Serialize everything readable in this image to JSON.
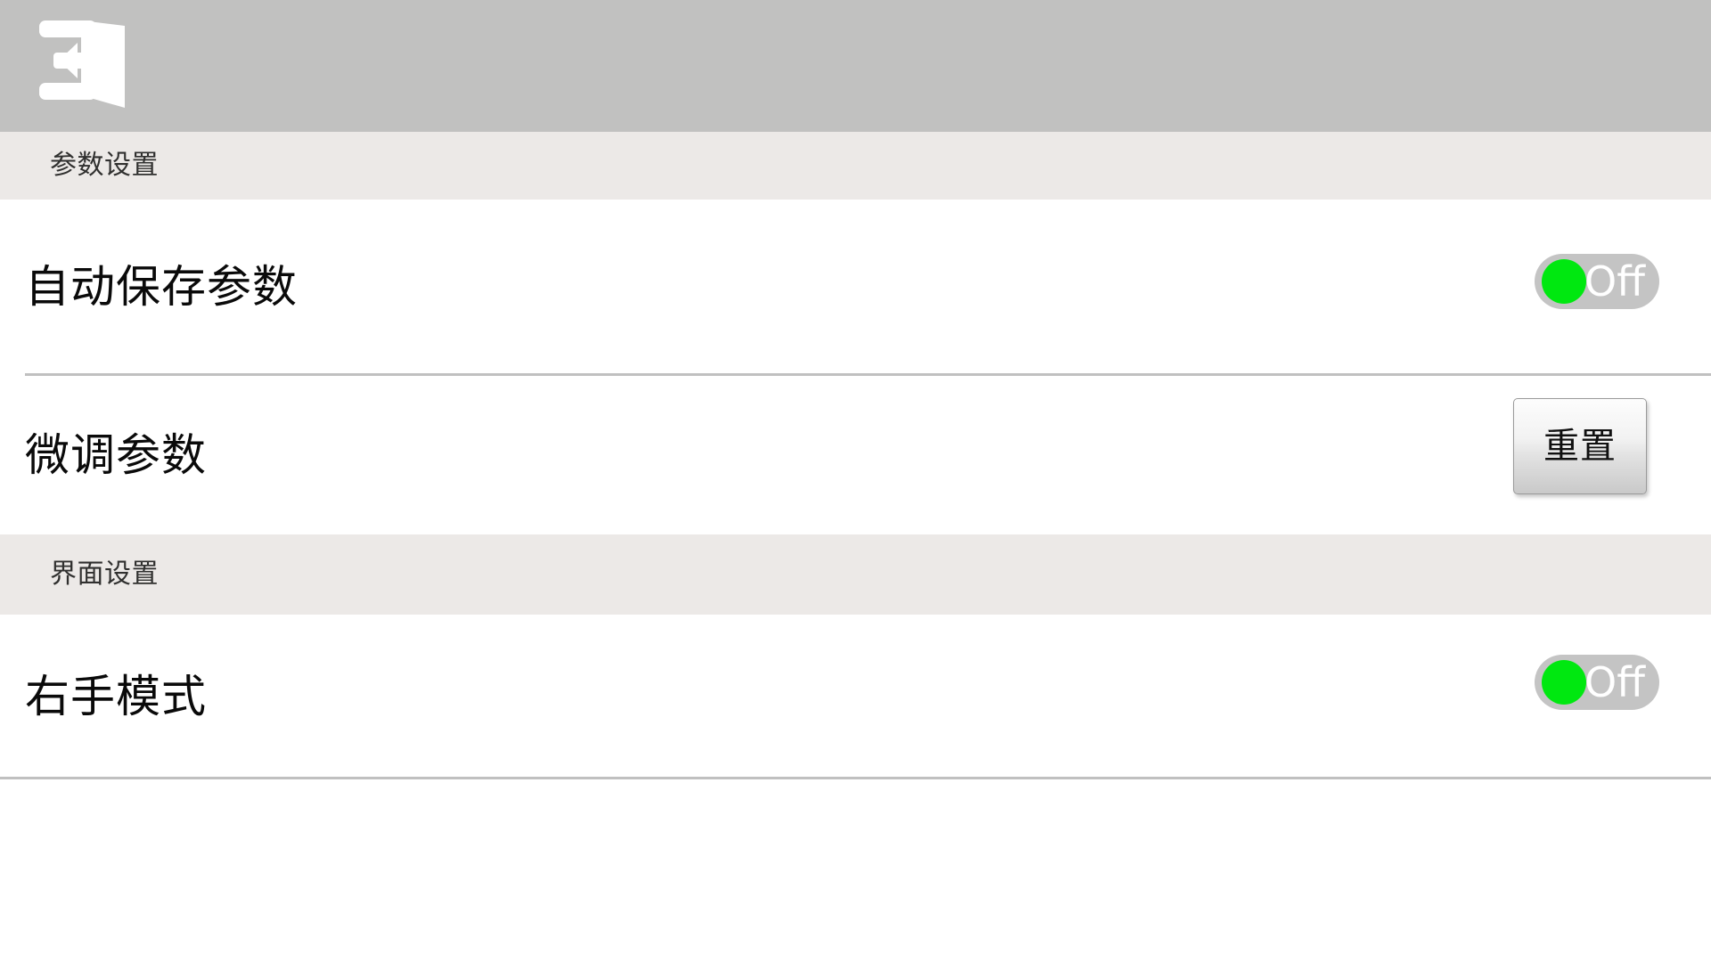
{
  "topbar": {
    "background_color": "#c1c1c0",
    "back_icon": "exit-door-icon",
    "back_icon_color": "#ffffff"
  },
  "theme": {
    "section_band_color": "#ece9e7",
    "row_background": "#ffffff",
    "divider_color": "#c0c0c0",
    "toggle_track_color": "#c4c4c4",
    "toggle_knob_color": "#00e810",
    "label_text_color": "#0a0a0a",
    "section_text_color": "#30302f"
  },
  "sections": [
    {
      "header": "参数设置",
      "rows": [
        {
          "label": "自动保存参数",
          "control": "toggle",
          "state_label": "Off",
          "knob_position": "left"
        },
        {
          "label": "微调参数",
          "control": "button",
          "button_label": "重置"
        }
      ]
    },
    {
      "header": "界面设置",
      "rows": [
        {
          "label": "右手模式",
          "control": "toggle",
          "state_label": "Off",
          "knob_position": "left"
        }
      ]
    }
  ]
}
